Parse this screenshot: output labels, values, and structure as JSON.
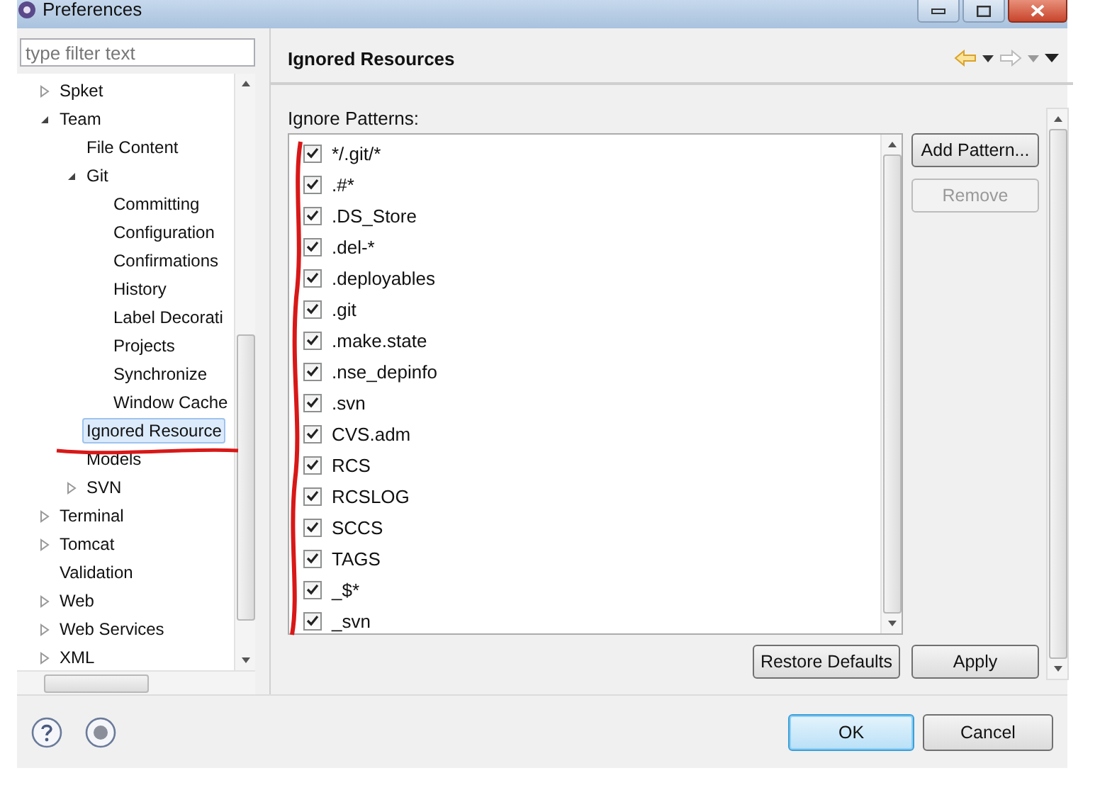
{
  "window": {
    "title": "Preferences"
  },
  "filter": {
    "placeholder": "type filter text"
  },
  "tree": {
    "items": [
      {
        "label": "Spket",
        "expanded": false,
        "selected": false
      },
      {
        "label": "Team",
        "expanded": true,
        "selected": false,
        "children": [
          {
            "label": "File Content",
            "selected": false
          },
          {
            "label": "Git",
            "expanded": true,
            "selected": false,
            "children": [
              {
                "label": "Committing",
                "selected": false
              },
              {
                "label": "Configuration",
                "selected": false
              },
              {
                "label": "Confirmations",
                "selected": false
              },
              {
                "label": "History",
                "selected": false
              },
              {
                "label": "Label Decorati",
                "selected": false
              },
              {
                "label": "Projects",
                "selected": false
              },
              {
                "label": "Synchronize",
                "selected": false
              },
              {
                "label": "Window Cache",
                "selected": false
              }
            ]
          },
          {
            "label": "Ignored Resource",
            "selected": true
          },
          {
            "label": "Models",
            "selected": false
          },
          {
            "label": "SVN",
            "expanded": false,
            "selected": false
          }
        ]
      },
      {
        "label": "Terminal",
        "expanded": false,
        "selected": false
      },
      {
        "label": "Tomcat",
        "expanded": false,
        "selected": false
      },
      {
        "label": "Validation",
        "selected": false
      },
      {
        "label": "Web",
        "expanded": false,
        "selected": false
      },
      {
        "label": "Web Services",
        "expanded": false,
        "selected": false
      },
      {
        "label": "XML",
        "expanded": false,
        "selected": false
      }
    ]
  },
  "page": {
    "title": "Ignored Resources",
    "section_label": "Ignore Patterns:",
    "patterns": [
      {
        "text": "*/.git/*",
        "checked": true
      },
      {
        "text": ".#*",
        "checked": true
      },
      {
        "text": ".DS_Store",
        "checked": true
      },
      {
        "text": ".del-*",
        "checked": true
      },
      {
        "text": ".deployables",
        "checked": true
      },
      {
        "text": ".git",
        "checked": true
      },
      {
        "text": ".make.state",
        "checked": true
      },
      {
        "text": ".nse_depinfo",
        "checked": true
      },
      {
        "text": ".svn",
        "checked": true
      },
      {
        "text": "CVS.adm",
        "checked": true
      },
      {
        "text": "RCS",
        "checked": true
      },
      {
        "text": "RCSLOG",
        "checked": true
      },
      {
        "text": "SCCS",
        "checked": true
      },
      {
        "text": "TAGS",
        "checked": true
      },
      {
        "text": "_$*",
        "checked": true
      },
      {
        "text": "_svn",
        "checked": true
      }
    ],
    "side_buttons": [
      {
        "label": "Add Pattern...",
        "disabled": false
      },
      {
        "label": "Remove",
        "disabled": true
      }
    ],
    "bottom_buttons": [
      "Restore Defaults",
      "Apply"
    ]
  },
  "dialog_buttons": [
    {
      "label": "OK",
      "default": true
    },
    {
      "label": "Cancel",
      "default": false
    }
  ]
}
